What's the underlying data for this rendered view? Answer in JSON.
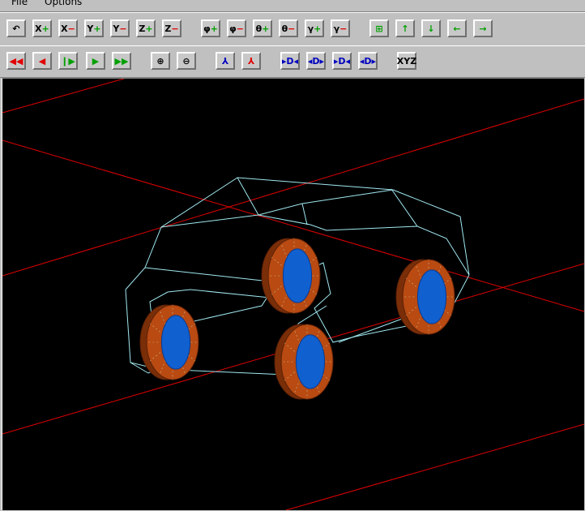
{
  "menu": {
    "file": "File",
    "options": "Options"
  },
  "toolbar1": [
    {
      "name": "undo-icon",
      "glyph": "↶",
      "cls": "k"
    },
    {
      "name": "x-plus-button",
      "label": "X",
      "sign": "+",
      "scls": "g"
    },
    {
      "name": "x-minus-button",
      "label": "X",
      "sign": "−",
      "scls": "r"
    },
    {
      "name": "y-plus-button",
      "label": "Y",
      "sign": "+",
      "scls": "g"
    },
    {
      "name": "y-minus-button",
      "label": "Y",
      "sign": "−",
      "scls": "r"
    },
    {
      "name": "z-plus-button",
      "label": "Z",
      "sign": "+",
      "scls": "g"
    },
    {
      "name": "z-minus-button",
      "label": "Z",
      "sign": "−",
      "scls": "r"
    },
    {
      "name": "phi-plus-button",
      "label": "φ",
      "sign": "+",
      "scls": "g"
    },
    {
      "name": "phi-minus-button",
      "label": "φ",
      "sign": "−",
      "scls": "r"
    },
    {
      "name": "theta-plus-button",
      "label": "θ",
      "sign": "+",
      "scls": "g"
    },
    {
      "name": "theta-minus-button",
      "label": "θ",
      "sign": "−",
      "scls": "r"
    },
    {
      "name": "gamma-plus-button",
      "label": "γ",
      "sign": "+",
      "scls": "g"
    },
    {
      "name": "gamma-minus-button",
      "label": "γ",
      "sign": "−",
      "scls": "r"
    },
    {
      "name": "grid-icon",
      "glyph": "⊞",
      "cls": "g"
    },
    {
      "name": "arrow-up-icon",
      "glyph": "↑",
      "cls": "g"
    },
    {
      "name": "arrow-down-icon",
      "glyph": "↓",
      "cls": "g"
    },
    {
      "name": "arrow-left-icon",
      "glyph": "←",
      "cls": "g"
    },
    {
      "name": "arrow-right-icon",
      "glyph": "→",
      "cls": "g"
    }
  ],
  "toolbar2": [
    {
      "name": "rewind-icon",
      "glyph": "◀◀",
      "cls": "r"
    },
    {
      "name": "step-back-icon",
      "glyph": "◀",
      "cls": "r"
    },
    {
      "name": "pause-play-icon",
      "glyph": "❙▶",
      "cls": "g"
    },
    {
      "name": "play-icon",
      "glyph": "▶",
      "cls": "g"
    },
    {
      "name": "fast-forward-icon",
      "glyph": "▶▶",
      "cls": "g"
    },
    {
      "name": "zoom-in-icon",
      "glyph": "⊕",
      "cls": "k"
    },
    {
      "name": "zoom-out-icon",
      "glyph": "⊖",
      "cls": "k"
    },
    {
      "name": "axes-rotate-left-icon",
      "glyph": "⅄",
      "cls": "b"
    },
    {
      "name": "axes-rotate-right-icon",
      "glyph": "⅄",
      "cls": "r"
    },
    {
      "name": "dolly-in-icon",
      "glyph": "▸D◂",
      "cls": "b"
    },
    {
      "name": "dolly-out-icon",
      "glyph": "◂D▸",
      "cls": "b"
    },
    {
      "name": "depth-plus-icon",
      "glyph": "▸D◂",
      "cls": "b"
    },
    {
      "name": "depth-minus-icon",
      "glyph": "◂D▸",
      "cls": "b"
    },
    {
      "name": "axes-xyz-icon",
      "glyph": "XYZ",
      "cls": "k"
    }
  ],
  "colors": {
    "background": "#000000",
    "wireframe": "#a0e8f0",
    "grid_lines": "#e00000",
    "tire": "#b84a12",
    "tire_dark": "#7a2e08",
    "hub": "#1060d0"
  }
}
